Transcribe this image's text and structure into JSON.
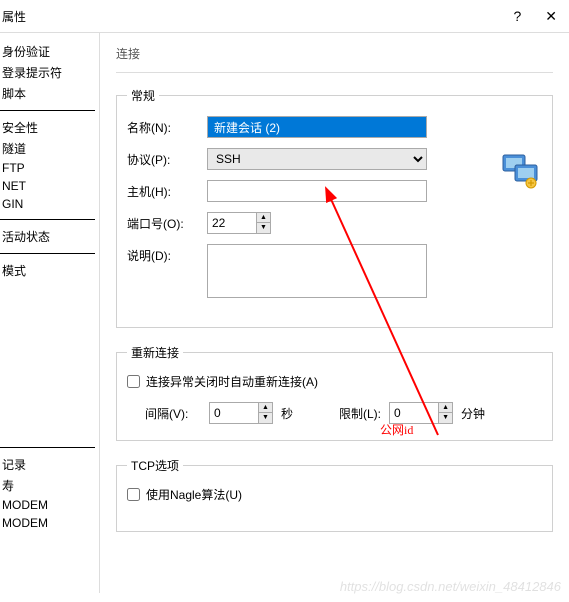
{
  "title": "属性",
  "titlebar": {
    "help": "?",
    "close": "✕"
  },
  "tab_label": "连接",
  "sidebar": {
    "items": [
      "身份验证",
      "登录提示符",
      "脚本",
      "",
      "安全性",
      "隧道",
      "FTP",
      "NET",
      "GIN",
      "",
      "活动状态",
      "",
      "模式"
    ],
    "items2": [
      "记录",
      "寿",
      "MODEM",
      "MODEM"
    ]
  },
  "group_general": {
    "legend": "常规",
    "name_label": "名称(N):",
    "name_value": "新建会话 (2)",
    "protocol_label": "协议(P):",
    "protocol_value": "SSH",
    "host_label": "主机(H):",
    "host_value": "",
    "port_label": "端口号(O):",
    "port_value": "22",
    "desc_label": "说明(D):",
    "desc_value": ""
  },
  "group_reconnect": {
    "legend": "重新连接",
    "check_label": "连接异常关闭时自动重新连接(A)",
    "interval_label": "间隔(V):",
    "interval_value": "0",
    "sec_label": "秒",
    "limit_label": "限制(L):",
    "limit_value": "0",
    "min_label": "分钟"
  },
  "group_tcp": {
    "legend": "TCP选项",
    "nagle_label": "使用Nagle算法(U)"
  },
  "annotation": "公网id",
  "watermark": "https://blog.csdn.net/weixin_48412846"
}
